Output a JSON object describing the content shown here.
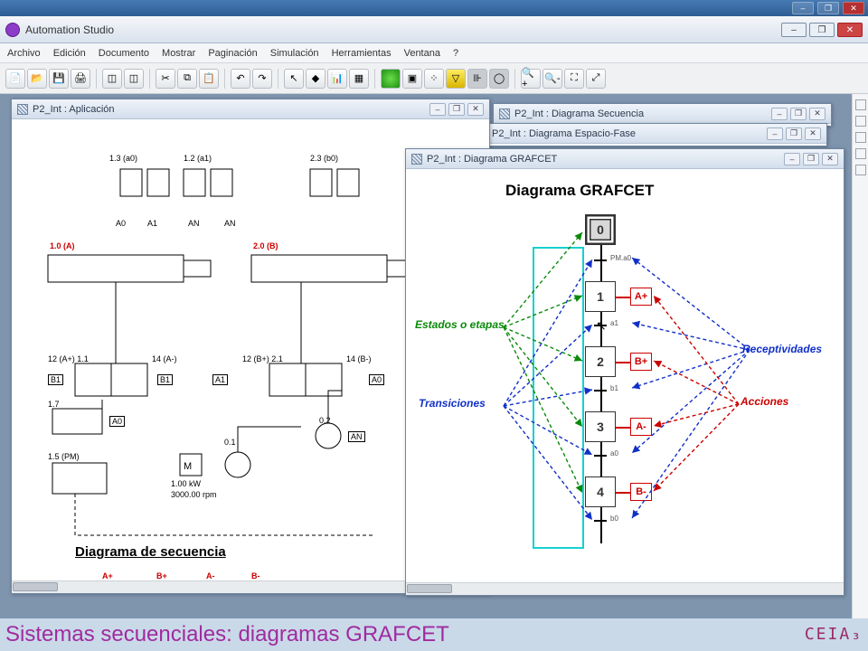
{
  "os": {
    "min": "–",
    "max": "❐",
    "close": "✕"
  },
  "app": {
    "title": "Automation Studio"
  },
  "menu": {
    "archivo": "Archivo",
    "edicion": "Edición",
    "documento": "Documento",
    "mostrar": "Mostrar",
    "paginacion": "Paginación",
    "simulacion": "Simulación",
    "herramientas": "Herramientas",
    "ventana": "Ventana",
    "ayuda": "?"
  },
  "windows": {
    "aplicacion": {
      "title": "P2_Int : Aplicación"
    },
    "secuencia": {
      "title": "P2_Int : Diagrama Secuencia"
    },
    "espaciofase": {
      "title": "P2_Int : Diagrama Espacio-Fase"
    },
    "grafcet": {
      "title": "P2_Int : Diagrama GRAFCET"
    }
  },
  "circuit": {
    "title": "Diagrama de secuencia",
    "cyl_a": "1.0 (A)",
    "cyl_b": "2.0 (B)",
    "p1": "1.3 (a0)",
    "p2": "1.2 (a1)",
    "p3": "2.3 (b0)",
    "a0": "A0",
    "a1": "A1",
    "an": "AN",
    "b1": "B1",
    "valve_a": "12 (A+) 1.1",
    "valve_a_r": "14 (A-)",
    "valve_b": "12 (B+) 2.1",
    "valve_b_r": "14 (B-)",
    "motor_hint1": "1.00 kW",
    "motor_hint2": "3000.00 rpm",
    "seq_Ap": "A+",
    "seq_Bp": "B+",
    "seq_Am": "A-",
    "seq_Bm": "B-",
    "v17": "1.7",
    "v15": "1.5 (PM)",
    "p01": "0.1",
    "p02": "0.2"
  },
  "grafcet": {
    "title": "Diagrama GRAFCET",
    "steps": [
      "0",
      "1",
      "2",
      "3",
      "4"
    ],
    "actions": [
      "A+",
      "B+",
      "A-",
      "B-"
    ],
    "trans": [
      "PM.a0",
      "a1",
      "b1",
      "a0",
      "b0"
    ],
    "anno_estados": "Estados o etapas",
    "anno_trans": "Transiciones",
    "anno_recept": "Receptividades",
    "anno_acciones": "Acciones"
  },
  "footer": {
    "caption": "Sistemas secuenciales: diagramas GRAFCET",
    "logo": "CEIA₃"
  }
}
